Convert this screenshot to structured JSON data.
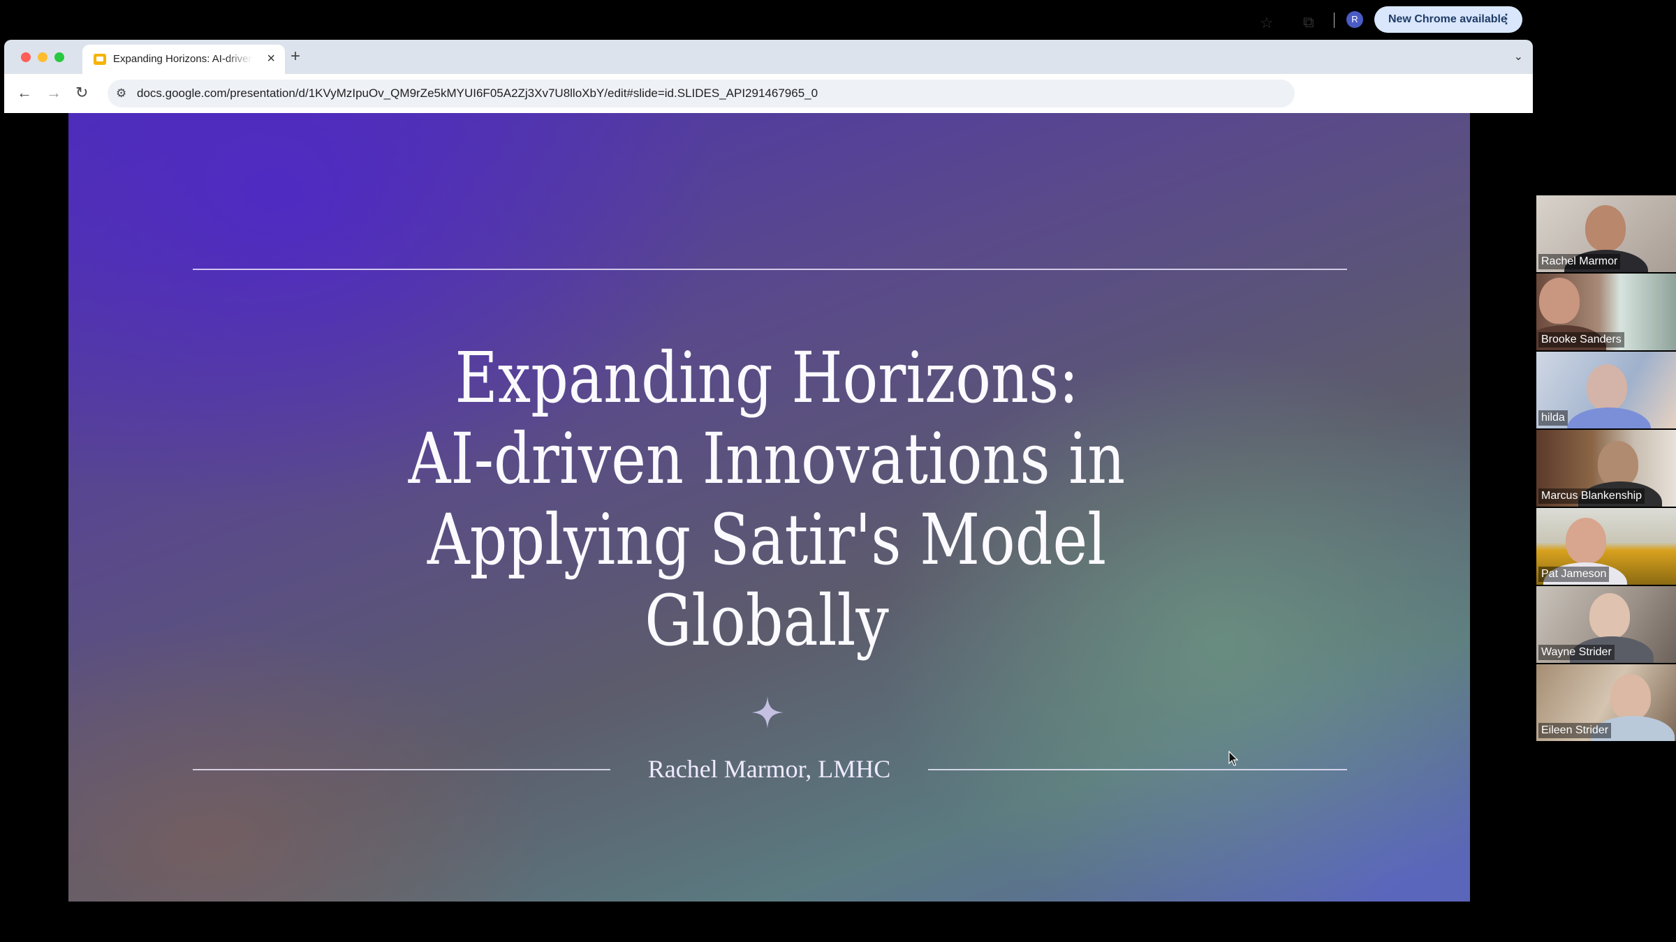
{
  "colors": {
    "traffic_close": "#ff5f57",
    "traffic_minimize": "#febc2e",
    "traffic_maximize": "#28c840",
    "slides_brand": "#f4b400",
    "profile_avatar": "#4b5bc4"
  },
  "browser": {
    "tab": {
      "title": "Expanding Horizons: AI-driven Innovations in Applying Satir's Model Globally",
      "close_glyph": "×",
      "favicon": "google-slides-icon"
    },
    "new_tab_glyph": "+",
    "tab_menu_glyph": "⌄",
    "nav": {
      "back_glyph": "←",
      "forward_glyph": "→",
      "reload_glyph": "↻"
    },
    "address_bar": {
      "site_info_glyph": "⚙",
      "url": "docs.google.com/presentation/d/1KVyMzIpuOv_QM9rZe5kMYUI6F05A2Zj3Xv7U8lloXbY/edit#slide=id.SLIDES_API291467965_0"
    },
    "bookmark_glyph": "☆",
    "extensions_glyph": "⧉",
    "profile_initial": "R",
    "update_chip": {
      "label": "New Chrome available",
      "menu_glyph": "⋮"
    }
  },
  "slide": {
    "title_lines": [
      "Expanding Horizons:",
      "AI-driven Innovations in",
      "Applying Satir's Model",
      "Globally"
    ],
    "subtitle": "Rachel Marmor, LMHC",
    "ornament": "sparkle-icon"
  },
  "participants": [
    {
      "name": "Rachel Marmor"
    },
    {
      "name": "Brooke Sanders"
    },
    {
      "name": "hilda"
    },
    {
      "name": "Marcus Blankenship"
    },
    {
      "name": "Pat Jameson"
    },
    {
      "name": "Wayne Strider"
    },
    {
      "name": "Eileen Strider"
    }
  ]
}
